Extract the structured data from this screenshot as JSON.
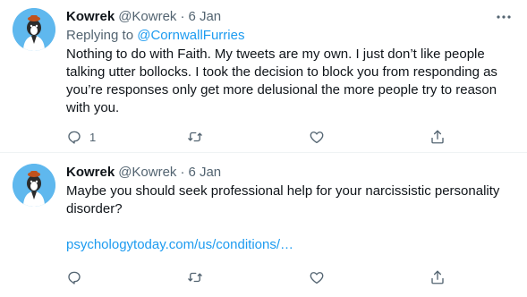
{
  "colors": {
    "accent": "#1d9bf0",
    "text": "#0f1419",
    "secondary": "#536471",
    "avatar_bg": "#5fb8ee"
  },
  "tweets": [
    {
      "name": "Kowrek",
      "handle": "@Kowrek",
      "separator": "·",
      "time": "6 Jan",
      "replying_to_label": "Replying to",
      "replying_to_handle": "@CornwallFurries",
      "text": "Nothing to do with Faith. My tweets are my own. I just don’t like people talking utter bollocks. I took the decision to block you from responding as you’re responses only get more delusional the more people try to reason with you.",
      "reply_count": "1",
      "icons": [
        "reply-icon",
        "retweet-icon",
        "like-icon",
        "share-icon",
        "more-icon"
      ]
    },
    {
      "name": "Kowrek",
      "handle": "@Kowrek",
      "separator": "·",
      "time": "6 Jan",
      "text": "Maybe you should seek professional help for your narcissistic personality disorder?",
      "link": "psychologytoday.com/us/conditions/…",
      "icons": [
        "reply-icon",
        "retweet-icon",
        "like-icon",
        "share-icon"
      ]
    }
  ]
}
